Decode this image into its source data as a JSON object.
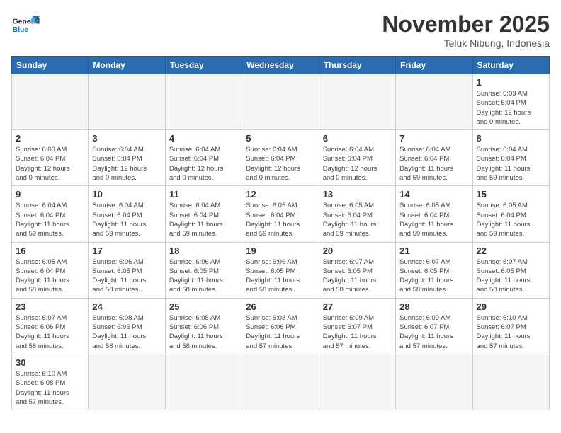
{
  "header": {
    "logo_general": "General",
    "logo_blue": "Blue",
    "month": "November 2025",
    "location": "Teluk Nibung, Indonesia"
  },
  "weekdays": [
    "Sunday",
    "Monday",
    "Tuesday",
    "Wednesday",
    "Thursday",
    "Friday",
    "Saturday"
  ],
  "days": [
    {
      "num": "",
      "info": ""
    },
    {
      "num": "",
      "info": ""
    },
    {
      "num": "",
      "info": ""
    },
    {
      "num": "",
      "info": ""
    },
    {
      "num": "",
      "info": ""
    },
    {
      "num": "",
      "info": ""
    },
    {
      "num": "1",
      "info": "Sunrise: 6:03 AM\nSunset: 6:04 PM\nDaylight: 12 hours\nand 0 minutes."
    },
    {
      "num": "2",
      "info": "Sunrise: 6:03 AM\nSunset: 6:04 PM\nDaylight: 12 hours\nand 0 minutes."
    },
    {
      "num": "3",
      "info": "Sunrise: 6:04 AM\nSunset: 6:04 PM\nDaylight: 12 hours\nand 0 minutes."
    },
    {
      "num": "4",
      "info": "Sunrise: 6:04 AM\nSunset: 6:04 PM\nDaylight: 12 hours\nand 0 minutes."
    },
    {
      "num": "5",
      "info": "Sunrise: 6:04 AM\nSunset: 6:04 PM\nDaylight: 12 hours\nand 0 minutes."
    },
    {
      "num": "6",
      "info": "Sunrise: 6:04 AM\nSunset: 6:04 PM\nDaylight: 12 hours\nand 0 minutes."
    },
    {
      "num": "7",
      "info": "Sunrise: 6:04 AM\nSunset: 6:04 PM\nDaylight: 11 hours\nand 59 minutes."
    },
    {
      "num": "8",
      "info": "Sunrise: 6:04 AM\nSunset: 6:04 PM\nDaylight: 11 hours\nand 59 minutes."
    },
    {
      "num": "9",
      "info": "Sunrise: 6:04 AM\nSunset: 6:04 PM\nDaylight: 11 hours\nand 59 minutes."
    },
    {
      "num": "10",
      "info": "Sunrise: 6:04 AM\nSunset: 6:04 PM\nDaylight: 11 hours\nand 59 minutes."
    },
    {
      "num": "11",
      "info": "Sunrise: 6:04 AM\nSunset: 6:04 PM\nDaylight: 11 hours\nand 59 minutes."
    },
    {
      "num": "12",
      "info": "Sunrise: 6:05 AM\nSunset: 6:04 PM\nDaylight: 11 hours\nand 59 minutes."
    },
    {
      "num": "13",
      "info": "Sunrise: 6:05 AM\nSunset: 6:04 PM\nDaylight: 11 hours\nand 59 minutes."
    },
    {
      "num": "14",
      "info": "Sunrise: 6:05 AM\nSunset: 6:04 PM\nDaylight: 11 hours\nand 59 minutes."
    },
    {
      "num": "15",
      "info": "Sunrise: 6:05 AM\nSunset: 6:04 PM\nDaylight: 11 hours\nand 59 minutes."
    },
    {
      "num": "16",
      "info": "Sunrise: 6:05 AM\nSunset: 6:04 PM\nDaylight: 11 hours\nand 58 minutes."
    },
    {
      "num": "17",
      "info": "Sunrise: 6:06 AM\nSunset: 6:05 PM\nDaylight: 11 hours\nand 58 minutes."
    },
    {
      "num": "18",
      "info": "Sunrise: 6:06 AM\nSunset: 6:05 PM\nDaylight: 11 hours\nand 58 minutes."
    },
    {
      "num": "19",
      "info": "Sunrise: 6:06 AM\nSunset: 6:05 PM\nDaylight: 11 hours\nand 58 minutes."
    },
    {
      "num": "20",
      "info": "Sunrise: 6:07 AM\nSunset: 6:05 PM\nDaylight: 11 hours\nand 58 minutes."
    },
    {
      "num": "21",
      "info": "Sunrise: 6:07 AM\nSunset: 6:05 PM\nDaylight: 11 hours\nand 58 minutes."
    },
    {
      "num": "22",
      "info": "Sunrise: 6:07 AM\nSunset: 6:05 PM\nDaylight: 11 hours\nand 58 minutes."
    },
    {
      "num": "23",
      "info": "Sunrise: 6:07 AM\nSunset: 6:06 PM\nDaylight: 11 hours\nand 58 minutes."
    },
    {
      "num": "24",
      "info": "Sunrise: 6:08 AM\nSunset: 6:06 PM\nDaylight: 11 hours\nand 58 minutes."
    },
    {
      "num": "25",
      "info": "Sunrise: 6:08 AM\nSunset: 6:06 PM\nDaylight: 11 hours\nand 58 minutes."
    },
    {
      "num": "26",
      "info": "Sunrise: 6:08 AM\nSunset: 6:06 PM\nDaylight: 11 hours\nand 57 minutes."
    },
    {
      "num": "27",
      "info": "Sunrise: 6:09 AM\nSunset: 6:07 PM\nDaylight: 11 hours\nand 57 minutes."
    },
    {
      "num": "28",
      "info": "Sunrise: 6:09 AM\nSunset: 6:07 PM\nDaylight: 11 hours\nand 57 minutes."
    },
    {
      "num": "29",
      "info": "Sunrise: 6:10 AM\nSunset: 6:07 PM\nDaylight: 11 hours\nand 57 minutes."
    },
    {
      "num": "30",
      "info": "Sunrise: 6:10 AM\nSunset: 6:08 PM\nDaylight: 11 hours\nand 57 minutes."
    },
    {
      "num": "",
      "info": ""
    },
    {
      "num": "",
      "info": ""
    },
    {
      "num": "",
      "info": ""
    },
    {
      "num": "",
      "info": ""
    },
    {
      "num": "",
      "info": ""
    },
    {
      "num": "",
      "info": ""
    }
  ]
}
